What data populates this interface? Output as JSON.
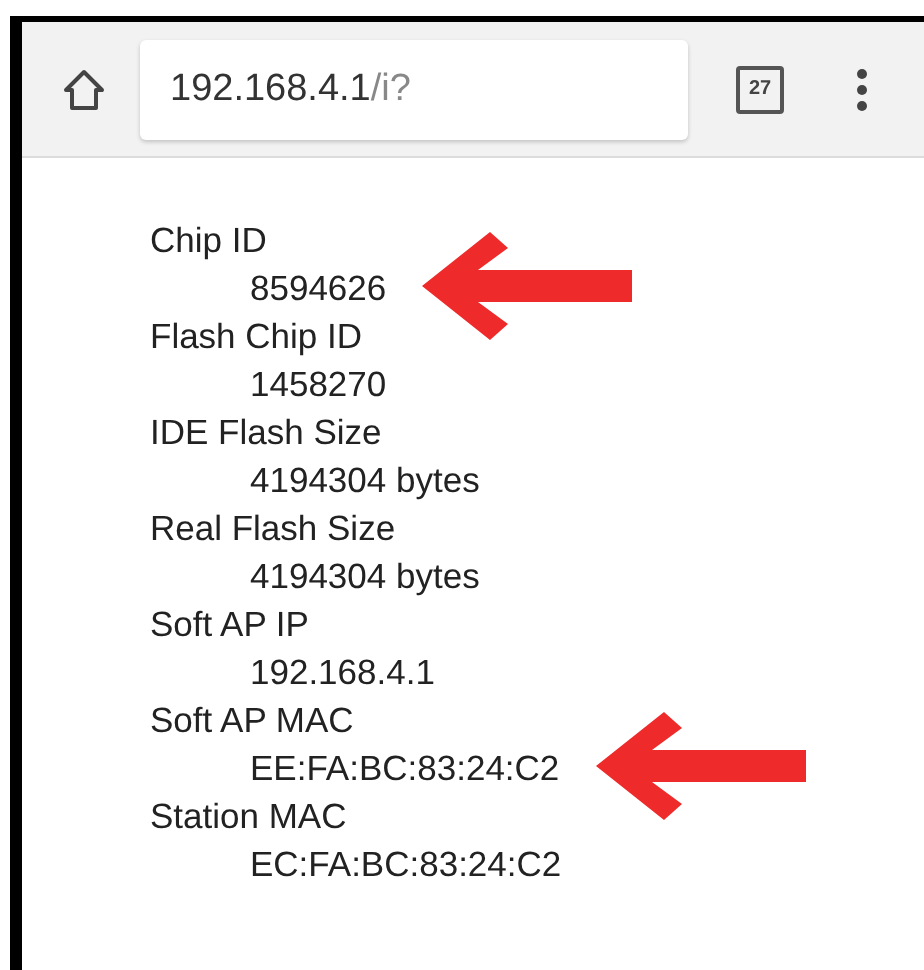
{
  "toolbar": {
    "url_host": "192.168.4.1",
    "url_path": "/i?",
    "tab_count": "27"
  },
  "info": [
    {
      "label": "Chip ID",
      "value": "8594626",
      "arrow": true
    },
    {
      "label": "Flash Chip ID",
      "value": "1458270",
      "arrow": false
    },
    {
      "label": "IDE Flash Size",
      "value": "4194304 bytes",
      "arrow": false
    },
    {
      "label": "Real Flash Size",
      "value": "4194304 bytes",
      "arrow": false
    },
    {
      "label": "Soft AP IP",
      "value": "192.168.4.1",
      "arrow": false
    },
    {
      "label": "Soft AP MAC",
      "value": "EE:FA:BC:83:24:C2",
      "arrow": true
    },
    {
      "label": "Station MAC",
      "value": "EC:FA:BC:83:24:C2",
      "arrow": false
    }
  ]
}
